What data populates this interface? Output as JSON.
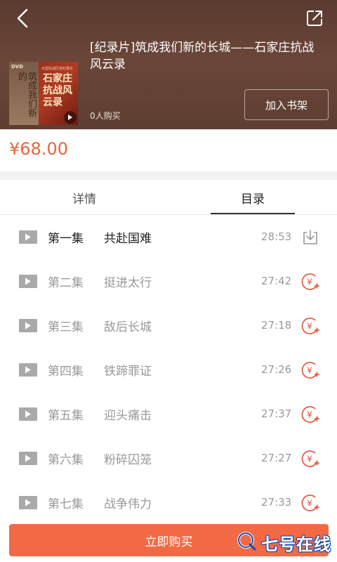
{
  "header": {
    "title": "[纪录片]筑成我们新的长城——石家庄抗战风云录",
    "buyers": "0人购买",
    "shelf_label": "加入书架",
    "cover": {
      "dvd": "DVD",
      "script": "筑成我们新的",
      "small": "大型抗战历史纪录片",
      "title": "石家庄抗战风云录"
    }
  },
  "price": "¥68.00",
  "tabs": {
    "details": "详情",
    "catalog": "目录",
    "active": "catalog"
  },
  "episodes": [
    {
      "ep": "第一集",
      "title": "共赴国难",
      "duration": "28:53",
      "action": "download"
    },
    {
      "ep": "第二集",
      "title": "挺进太行",
      "duration": "27:42",
      "action": "buy"
    },
    {
      "ep": "第三集",
      "title": "敌后长城",
      "duration": "27:18",
      "action": "buy"
    },
    {
      "ep": "第四集",
      "title": "铁蹄罪证",
      "duration": "27:26",
      "action": "buy"
    },
    {
      "ep": "第五集",
      "title": "迎头痛击",
      "duration": "27:37",
      "action": "buy"
    },
    {
      "ep": "第六集",
      "title": "粉碎囚笼",
      "duration": "27:27",
      "action": "buy"
    },
    {
      "ep": "第七集",
      "title": "战争伟力",
      "duration": "27:33",
      "action": "buy"
    }
  ],
  "buy_now_label": "立即购买",
  "watermark": {
    "text": "七号在线"
  },
  "colors": {
    "accent": "#f26a45",
    "price": "#e8643c",
    "buy_icon": "#e0533a",
    "header_bg": "#5e3e32"
  },
  "icons": {
    "back": "back-arrow-icon",
    "share": "share-icon",
    "play": "play-icon",
    "download": "download-icon",
    "buy": "yuan-plus-icon"
  }
}
